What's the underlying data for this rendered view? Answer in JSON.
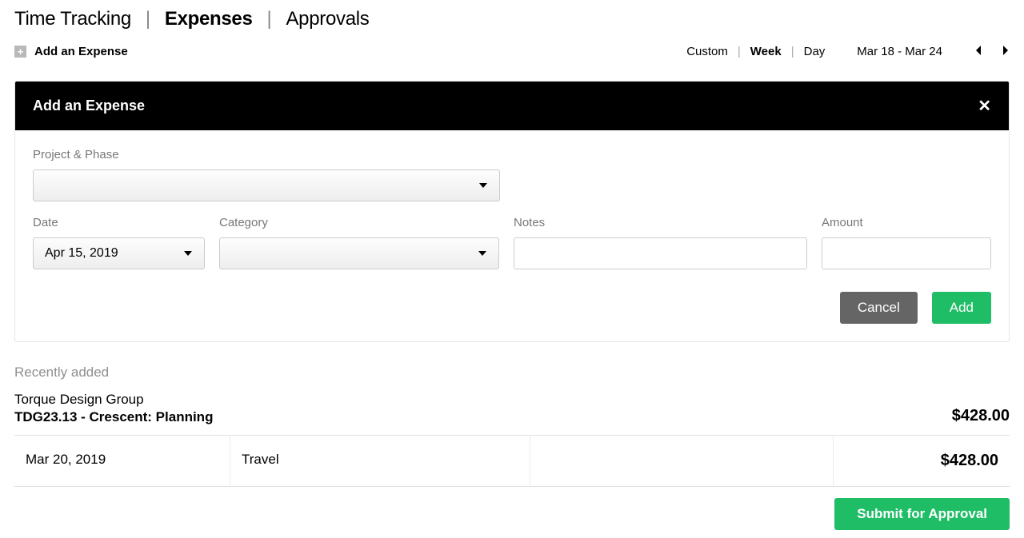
{
  "tabs": {
    "time_tracking": "Time Tracking",
    "expenses": "Expenses",
    "approvals": "Approvals"
  },
  "toolbar": {
    "add_expense_label": "Add an Expense",
    "view_modes": {
      "custom": "Custom",
      "week": "Week",
      "day": "Day"
    },
    "date_range": "Mar 18 - Mar 24"
  },
  "panel": {
    "title": "Add an Expense",
    "labels": {
      "project_phase": "Project & Phase",
      "date": "Date",
      "category": "Category",
      "notes": "Notes",
      "amount": "Amount"
    },
    "values": {
      "project_phase": "",
      "date": "Apr 15, 2019",
      "category": "",
      "notes": "",
      "amount": ""
    },
    "buttons": {
      "cancel": "Cancel",
      "add": "Add"
    }
  },
  "recent": {
    "heading": "Recently added",
    "group": {
      "client": "Torque Design Group",
      "project": "TDG23.13 - Crescent: Planning",
      "total": "$428.00"
    },
    "rows": [
      {
        "date": "Mar 20, 2019",
        "category": "Travel",
        "amount": "$428.00"
      }
    ]
  },
  "submit_label": "Submit for Approval"
}
